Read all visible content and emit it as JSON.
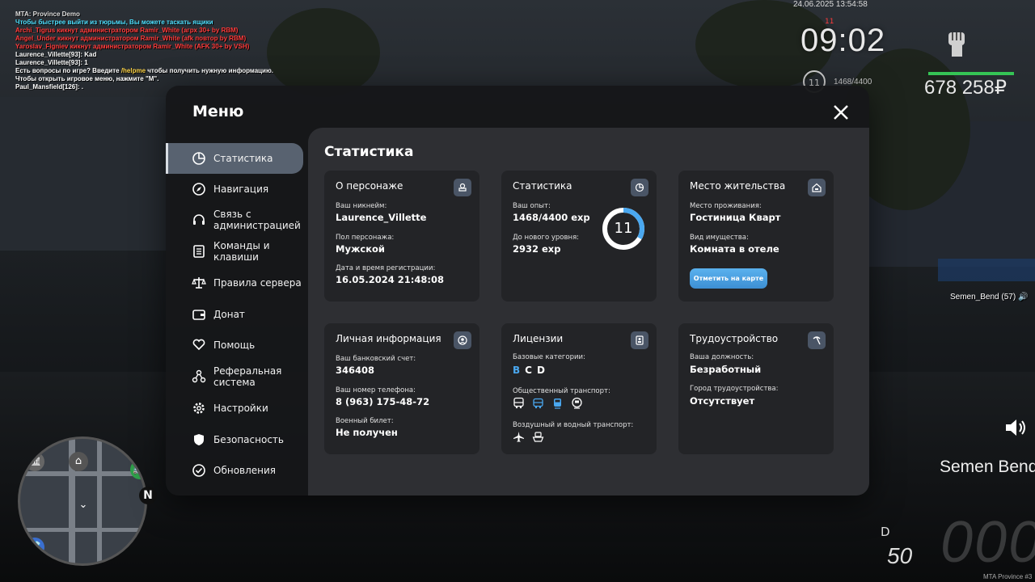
{
  "chat": {
    "lines": [
      {
        "text": "MTA: Province Demo",
        "color": "#dedede"
      },
      {
        "text": "Чтобы быстрее выйти из тюрьмы, Вы можете таскать ящики",
        "color": "#4ee0ff"
      },
      {
        "text": "Archi_Tigrus кикнут администратором Ramir_White (агрх 30+ by RBM)",
        "color": "#ff3b3b"
      },
      {
        "text": "Angel_Under кикнут администратором Ramir_White (afk повтор by RBM)",
        "color": "#ff3b3b"
      },
      {
        "text": "Yaroslav_Figniev кикнут администратором Ramir_White (AFK 30+ by VSH)",
        "color": "#ff3b3b"
      },
      {
        "text": "Laurence_Villette[93]: Kad",
        "color": "#ffffff"
      },
      {
        "text": "Laurence_Villette[93]: 1",
        "color": "#ffffff"
      },
      {
        "text_pre": "Есть вопросы по игре? Введите ",
        "highlight": "/helpme",
        "text_post": " чтобы получить нужную информацию.",
        "color": "#ffffff"
      },
      {
        "text": "Чтобы открыть игровое меню, нажмите \"M\".",
        "color": "#ffffff"
      },
      {
        "text": "Paul_Mansfield[126]: .",
        "color": "#ffffff"
      }
    ]
  },
  "hud": {
    "datetime": "24.06.2025 13:54:58",
    "time_top": "11",
    "time": "09:02",
    "level": "11",
    "exp": "1468/4400",
    "money": "678 258₽",
    "player_tag": "Semen_Bend (57)",
    "player_big": "Semen Bend",
    "gear": "D",
    "fuel": "50",
    "speed": "000",
    "watermark": "MTA Province #3"
  },
  "minimap": {
    "north": "N"
  },
  "menu": {
    "title": "Меню",
    "sidebar": [
      {
        "label": "Статистика",
        "icon": "pie-chart-icon",
        "active": true
      },
      {
        "label": "Навигация",
        "icon": "compass-icon"
      },
      {
        "label": "Связь с администрацией",
        "icon": "headset-icon"
      },
      {
        "label": "Команды и клавиши",
        "icon": "document-icon"
      },
      {
        "label": "Правила сервера",
        "icon": "scales-icon"
      },
      {
        "label": "Донат",
        "icon": "wallet-icon"
      },
      {
        "label": "Помощь",
        "icon": "heart-hands-icon"
      },
      {
        "label": "Реферальная система",
        "icon": "network-icon"
      },
      {
        "label": "Настройки",
        "icon": "gear-icon"
      },
      {
        "label": "Безопасность",
        "icon": "shield-icon"
      },
      {
        "label": "Обновления",
        "icon": "check-circle-icon"
      }
    ],
    "content_title": "Статистика",
    "cards": {
      "character": {
        "title": "О персонаже",
        "nickname_label": "Ваш никнейм:",
        "nickname": "Laurence_Villette",
        "gender_label": "Пол персонажа:",
        "gender": "Мужской",
        "reg_label": "Дата и время регистрации:",
        "reg": "16.05.2024 21:48:08"
      },
      "stats": {
        "title": "Статистика",
        "exp_label": "Ваш опыт:",
        "exp": "1468/4400 exp",
        "next_label": "До нового уровня:",
        "next": "2932 exp",
        "level": "11",
        "progress": 0.3336
      },
      "residence": {
        "title": "Место жительства",
        "place_label": "Место проживания:",
        "place": "Гостиница Кварт",
        "property_label": "Вид имущества:",
        "property": "Комната в отеле",
        "button": "Отметить на карте"
      },
      "personal": {
        "title": "Личная информация",
        "bank_label": "Ваш банковский счет:",
        "bank": "346408",
        "phone_label": "Ваш номер телефона:",
        "phone": "8 (963) 175-48-72",
        "military_label": "Военный билет:",
        "military": "Не получен"
      },
      "licenses": {
        "title": "Лицензии",
        "basic_label": "Базовые категории:",
        "categories": [
          "B",
          "C",
          "D"
        ],
        "public_label": "Общественный транспорт:",
        "air_label": "Воздушный и водный транспорт:"
      },
      "employment": {
        "title": "Трудоустройство",
        "position_label": "Ваша должность:",
        "position": "Безработный",
        "city_label": "Город трудоустройства:",
        "city": "Отсутствует"
      }
    }
  },
  "colors": {
    "accent": "#4aa8f0",
    "active_tab": "#586270",
    "card_bg": "#232427",
    "money_bar": "#35c455"
  }
}
